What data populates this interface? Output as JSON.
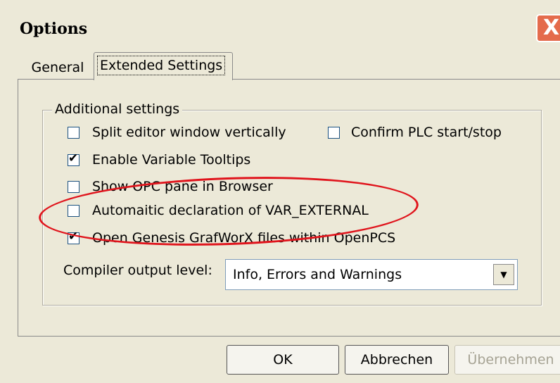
{
  "window": {
    "title": "Options",
    "close_label": "X"
  },
  "tabs": [
    {
      "label": "General",
      "selected": false
    },
    {
      "label": "Extended Settings",
      "selected": true
    }
  ],
  "group": {
    "label": "Additional settings"
  },
  "options": [
    {
      "label": "Split editor window vertically",
      "checked": false
    },
    {
      "label": "Confirm PLC start/stop",
      "checked": false
    },
    {
      "label": "Enable Variable Tooltips",
      "checked": true
    },
    {
      "label": "Show OPC pane in Browser",
      "checked": false
    },
    {
      "label": "Automaitic declaration of VAR_EXTERNAL",
      "checked": false
    },
    {
      "label": "Open Genesis GrafWorX files within OpenPCS",
      "checked": true
    }
  ],
  "compiler": {
    "label": "Compiler output level:",
    "value": "Info, Errors and Warnings"
  },
  "buttons": {
    "ok": "OK",
    "cancel": "Abbrechen",
    "apply": "Übernehmen"
  },
  "colors": {
    "annotation": "#e0141c",
    "background": "#ece9d8"
  }
}
